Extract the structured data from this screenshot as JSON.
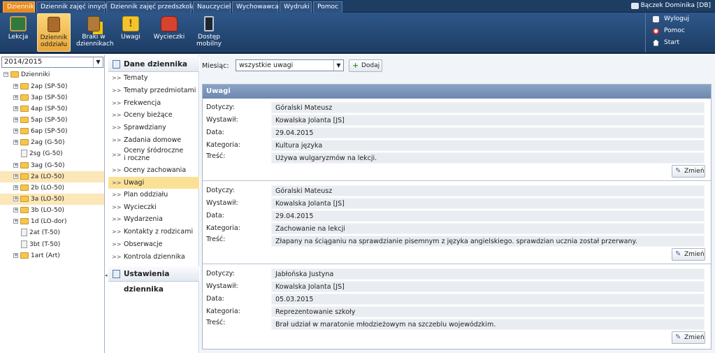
{
  "menubar": {
    "tabs": [
      "Dziennik",
      "Dziennik zajęć innych",
      "Dziennik zajęć przedszkola",
      "Nauczyciel",
      "Wychowawca",
      "Wydruki",
      "Pomoc"
    ],
    "active_tab": "Dziennik",
    "user": "Bączek Dominika [DB]"
  },
  "toolbar": {
    "buttons": [
      "Lekcja",
      "Dziennik oddziału",
      "Braki w dziennikach",
      "Uwagi",
      "Wycieczki",
      "Dostęp mobilny"
    ],
    "active": "Dziennik oddziału",
    "right_links": [
      "Wyloguj",
      "Pomoc",
      "Start"
    ]
  },
  "tree": {
    "year": "2014/2015",
    "root": "Dzienniki",
    "nodes": [
      "2ap (SP-50)",
      "3ap (SP-50)",
      "4ap (SP-50)",
      "5ap (SP-50)",
      "6ap (SP-50)",
      "2ag (G-50)",
      "2sg (G-50)",
      "3ag (G-50)",
      "2a (LO-50)",
      "2b (LO-50)",
      "3a (LO-50)",
      "3b (LO-50)",
      "1d (LO-dor)",
      "2at (T-50)",
      "3bt (T-50)",
      "1art (Art)"
    ],
    "selected": "3a (LO-50)"
  },
  "menu": {
    "header1": "Dane dziennika",
    "items": [
      "Tematy",
      "Tematy przedmiotami",
      "Frekwencja",
      "Oceny bieżące",
      "Sprawdziany",
      "Zadania domowe",
      "Oceny śródroczne i roczne",
      "Oceny zachowania",
      "Uwagi",
      "Plan oddziału",
      "Wycieczki",
      "Wydarzenia",
      "Kontakty z rodzicami",
      "Obserwacje",
      "Kontrola dziennika"
    ],
    "selected": "Uwagi",
    "header2": "Ustawienia dziennika"
  },
  "filter": {
    "label": "Miesiąc:",
    "value": "wszystkie uwagi",
    "add_label": "Dodaj"
  },
  "panel": {
    "title": "Uwagi",
    "field_labels": [
      "Dotyczy:",
      "Wystawił:",
      "Data:",
      "Kategoria:",
      "Treść:"
    ],
    "edit_label": "Zmień",
    "records": [
      {
        "dotyczy": "Góralski Mateusz",
        "wystawil": "Kowalska Jolanta [JS]",
        "data": "29.04.2015",
        "kategoria": "Kultura języka",
        "tresc": "Używa wulgaryzmów na lekcji."
      },
      {
        "dotyczy": "Góralski Mateusz",
        "wystawil": "Kowalska Jolanta [JS]",
        "data": "29.04.2015",
        "kategoria": "Zachowanie na lekcji",
        "tresc": "Złapany na ściąganiu na sprawdzianie pisemnym z języka angielskiego. sprawdzian ucznia został przerwany."
      },
      {
        "dotyczy": "Jabłońska Justyna",
        "wystawil": "Kowalska Jolanta [JS]",
        "data": "05.03.2015",
        "kategoria": "Reprezentowanie szkoły",
        "tresc": "Brał udział w maratonie młodzieżowym na szczeblu wojewódzkim."
      }
    ]
  },
  "colors": {
    "nav": "#1d3d63",
    "accent": "#e88b1f",
    "selected": "#fbe198",
    "panel_header": "#7c95bb"
  }
}
